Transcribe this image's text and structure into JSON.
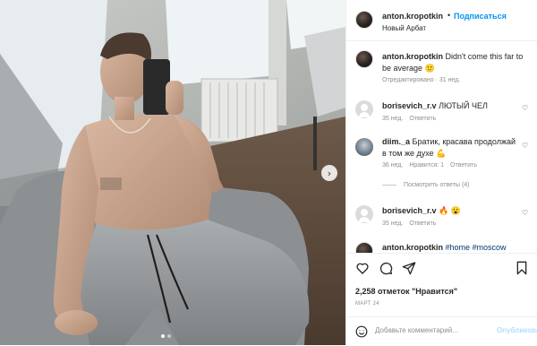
{
  "header": {
    "username": "anton.kropotkin",
    "separator": "•",
    "follow_label": "Подписаться",
    "location": "Новый Арбат"
  },
  "caption": {
    "username": "anton.kropotkin",
    "text": "Didn't come this far to be average",
    "emoji": "🙂",
    "meta": "Отредактировано · 31 нед."
  },
  "comments": [
    {
      "username": "borisevich_r.v",
      "text": "ЛЮТЫЙ ЧЕЛ",
      "age": "35 нед.",
      "replies": "",
      "reply_label": "Ответить"
    },
    {
      "username": "diim._a",
      "text": "Братик, красава продолжай в том же духе",
      "emoji": "💪",
      "age": "36 нед.",
      "replies": "Нравится: 1",
      "reply_label": "Ответить"
    },
    {
      "username": "borisevich_r.v",
      "text": "",
      "emoji": "🔥 😮",
      "age": "35 нед.",
      "replies": "",
      "reply_label": "Ответить"
    }
  ],
  "view_replies": "Посмотреть ответы (4)",
  "partial_comment": {
    "username": "anton.kropotkin",
    "tags": "#home #moscow"
  },
  "likes": "2,258 отметок \"Нравится\"",
  "date": "МАРТ 24",
  "add_comment": {
    "placeholder": "Добавьте комментарий...",
    "publish_label": "Опубликовать"
  },
  "icons": [
    "heart-icon",
    "comment-icon",
    "share-icon",
    "bookmark-icon",
    "emoji-icon",
    "chevron-right-icon"
  ],
  "colors": {
    "accent": "#0095f6",
    "publish_disabled": "#b2dffc",
    "muted": "#8e8e8e",
    "hashtag": "#00376b"
  }
}
